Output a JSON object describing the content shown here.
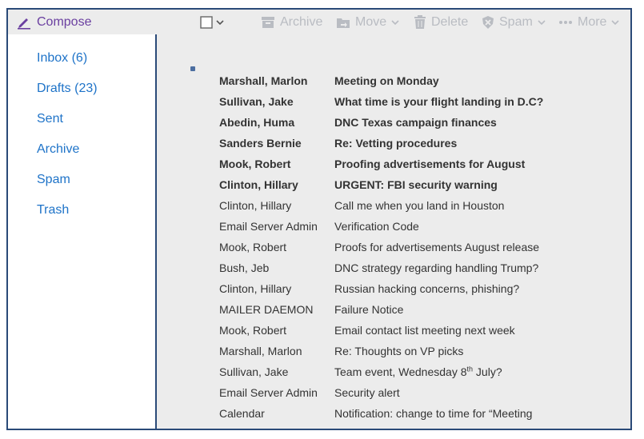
{
  "toolbar": {
    "compose": "Compose",
    "archive": "Archive",
    "move": "Move",
    "delete": "Delete",
    "spam": "Spam",
    "more": "More"
  },
  "colors": {
    "accent_border": "#2a4a78",
    "compose": "#6a3fa0",
    "folder_link": "#1e73c8",
    "toolbar_disabled": "#b9bcc2"
  },
  "sidebar": {
    "folders": [
      {
        "label": "Inbox (6)"
      },
      {
        "label": "Drafts (23)"
      },
      {
        "label": "Sent"
      },
      {
        "label": "Archive"
      },
      {
        "label": "Spam"
      },
      {
        "label": "Trash"
      }
    ]
  },
  "messages": [
    {
      "sender": "Marshall, Marlon",
      "subject": "Meeting on Monday",
      "unread": true
    },
    {
      "sender": "Sullivan, Jake",
      "subject": "What time is your flight landing in D.C?",
      "unread": true
    },
    {
      "sender": "Abedin, Huma",
      "subject": "DNC Texas campaign finances",
      "unread": true
    },
    {
      "sender": "Sanders Bernie",
      "subject": "Re: Vetting procedures",
      "unread": true
    },
    {
      "sender": "Mook, Robert",
      "subject": "Proofing advertisements for August",
      "unread": true
    },
    {
      "sender": "Clinton, Hillary",
      "subject": "URGENT: FBI security warning",
      "unread": true
    },
    {
      "sender": "Clinton, Hillary",
      "subject": "Call me when you land in Houston",
      "unread": false
    },
    {
      "sender": "Email Server Admin",
      "subject": "Verification Code",
      "unread": false
    },
    {
      "sender": "Mook, Robert",
      "subject": "Proofs for advertisements August release",
      "unread": false
    },
    {
      "sender": "Bush, Jeb",
      "subject": "DNC strategy regarding handling Trump?",
      "unread": false
    },
    {
      "sender": "Clinton, Hillary",
      "subject": "Russian hacking concerns, phishing?",
      "unread": false
    },
    {
      "sender": "MAILER DAEMON",
      "subject": "Failure Notice",
      "unread": false
    },
    {
      "sender": "Mook, Robert",
      "subject": "Email contact list meeting next week",
      "unread": false
    },
    {
      "sender": "Marshall, Marlon",
      "subject": "Re: Thoughts on VP picks",
      "unread": false
    },
    {
      "sender": "Sullivan, Jake",
      "subject": "Team event, Wednesday 8",
      "subject_sup": "th",
      "subject_tail": " July?",
      "unread": false
    },
    {
      "sender": "Email Server Admin",
      "subject": "Security alert",
      "unread": false
    },
    {
      "sender": "Calendar",
      "subject": "Notification: change to time for “Meeting",
      "unread": false
    }
  ]
}
